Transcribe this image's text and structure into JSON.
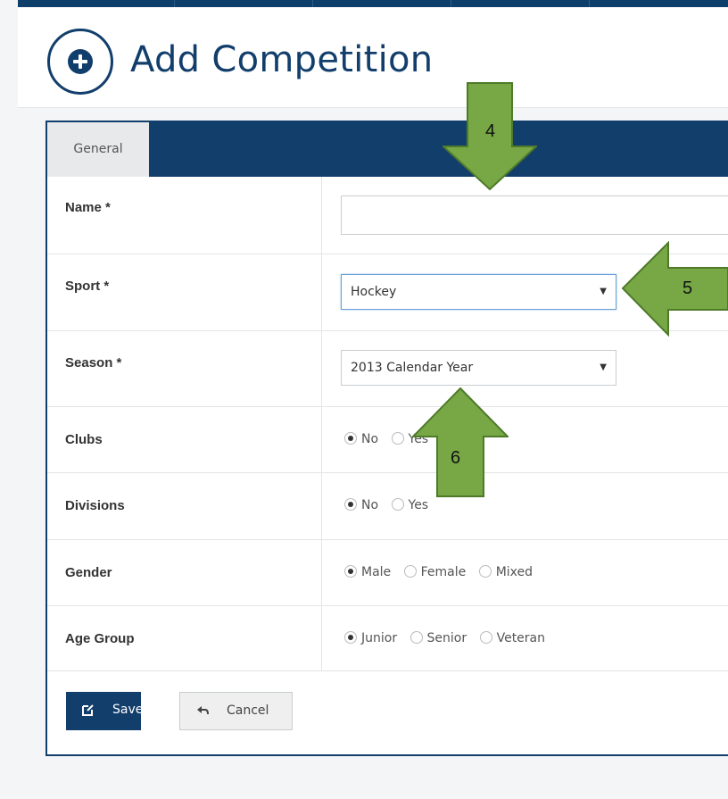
{
  "page": {
    "title": "Add Competition",
    "header_icon": "plus-circle-icon"
  },
  "tabs": [
    {
      "label": "General"
    }
  ],
  "form": {
    "name": {
      "label": "Name *",
      "value": ""
    },
    "sport": {
      "label": "Sport *",
      "value": "Hockey"
    },
    "season": {
      "label": "Season *",
      "value": "2013 Calendar Year"
    },
    "clubs": {
      "label": "Clubs",
      "options": [
        "No",
        "Yes"
      ],
      "selected": "No"
    },
    "divisions": {
      "label": "Divisions",
      "options": [
        "No",
        "Yes"
      ],
      "selected": "No"
    },
    "gender": {
      "label": "Gender",
      "options": [
        "Male",
        "Female",
        "Mixed"
      ],
      "selected": "Male"
    },
    "age_group": {
      "label": "Age Group",
      "options": [
        "Junior",
        "Senior",
        "Veteran"
      ],
      "selected": "Junior"
    }
  },
  "buttons": {
    "save": "Save",
    "cancel": "Cancel"
  },
  "callouts": [
    {
      "number": "4",
      "direction": "down"
    },
    {
      "number": "5",
      "direction": "left"
    },
    {
      "number": "6",
      "direction": "up"
    }
  ],
  "colors": {
    "primary": "#123e6c",
    "arrow_fill": "#77a845",
    "arrow_stroke": "#4e7a2a"
  }
}
